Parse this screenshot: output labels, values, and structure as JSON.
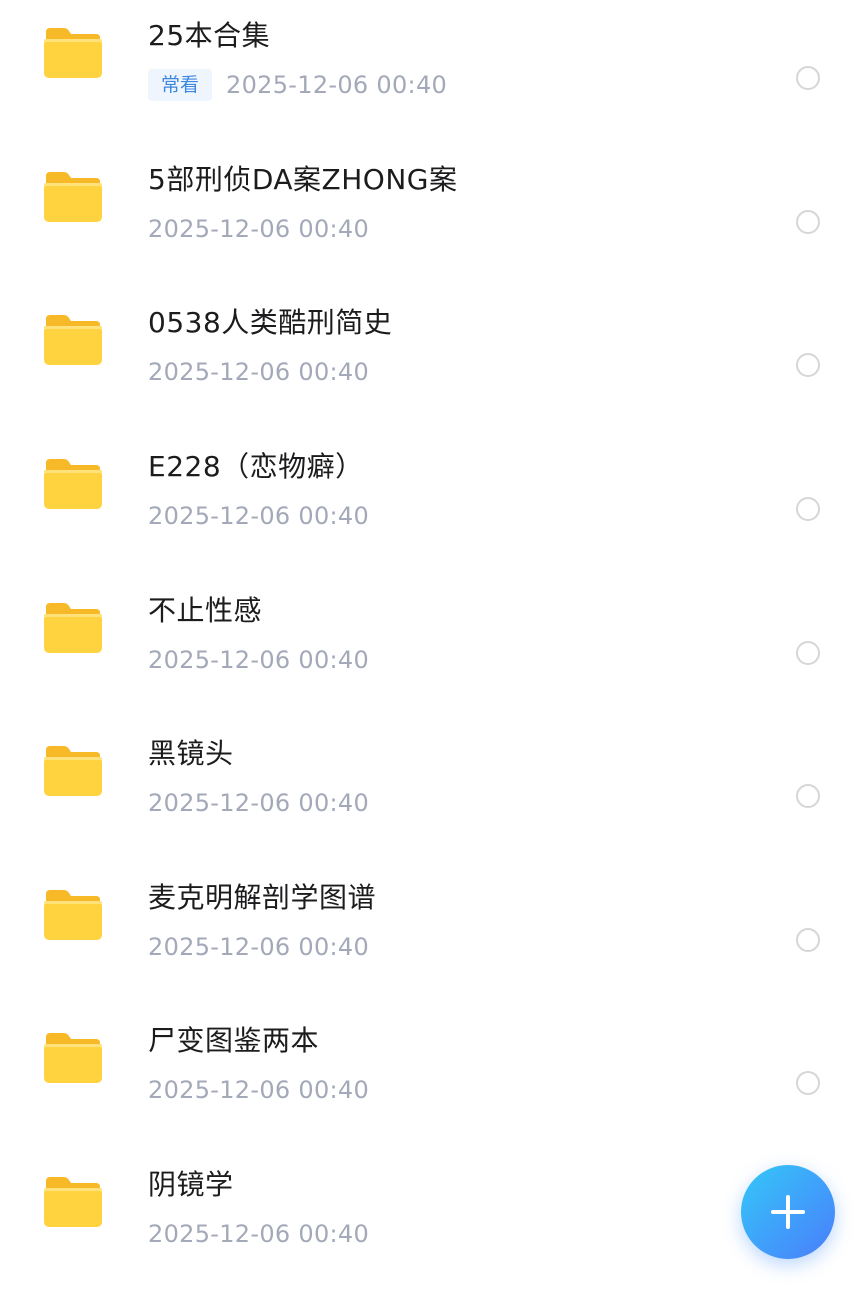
{
  "files": [
    {
      "name": "25本合集",
      "badge": "常看",
      "date": "2025-12-06  00:40"
    },
    {
      "name": "5部刑侦DA案ZHONG案",
      "date": "2025-12-06  00:40"
    },
    {
      "name": "0538人类酷刑简史",
      "date": "2025-12-06  00:40"
    },
    {
      "name": "E228（恋物癖）",
      "date": "2025-12-06  00:40"
    },
    {
      "name": "不止性感",
      "date": "2025-12-06  00:40"
    },
    {
      "name": "黑镜头",
      "date": "2025-12-06  00:40"
    },
    {
      "name": "麦克明解剖学图谱",
      "date": "2025-12-06  00:40"
    },
    {
      "name": "尸变图鉴两本",
      "date": "2025-12-06  00:40"
    },
    {
      "name": "阴镜学",
      "date": "2025-12-06  00:40"
    }
  ],
  "icons": {
    "folder": "folder-icon",
    "select": "radio-circle-icon",
    "add": "plus-icon"
  },
  "colors": {
    "folder_body": "#FFD23F",
    "folder_tab": "#F7B928",
    "badge_text": "#3D88E0",
    "date_text": "#A3A9B8",
    "fab_start": "#34C8F9",
    "fab_end": "#4A7DFA"
  }
}
